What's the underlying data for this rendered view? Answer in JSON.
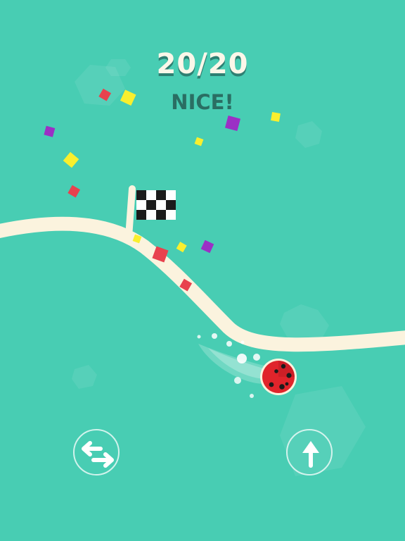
{
  "hud": {
    "progress_text": "20/20",
    "status_text": "NICE!"
  },
  "controls": {
    "swap_icon": "swap-arrows-icon",
    "jump_icon": "arrow-up-icon"
  },
  "colors": {
    "background": "#48CDB3",
    "track": "#FBF3DE",
    "ball": "#E0242B",
    "confetti_red": "#E8424E",
    "confetti_yellow": "#F9EF2E",
    "confetti_purple": "#9B30C5"
  }
}
